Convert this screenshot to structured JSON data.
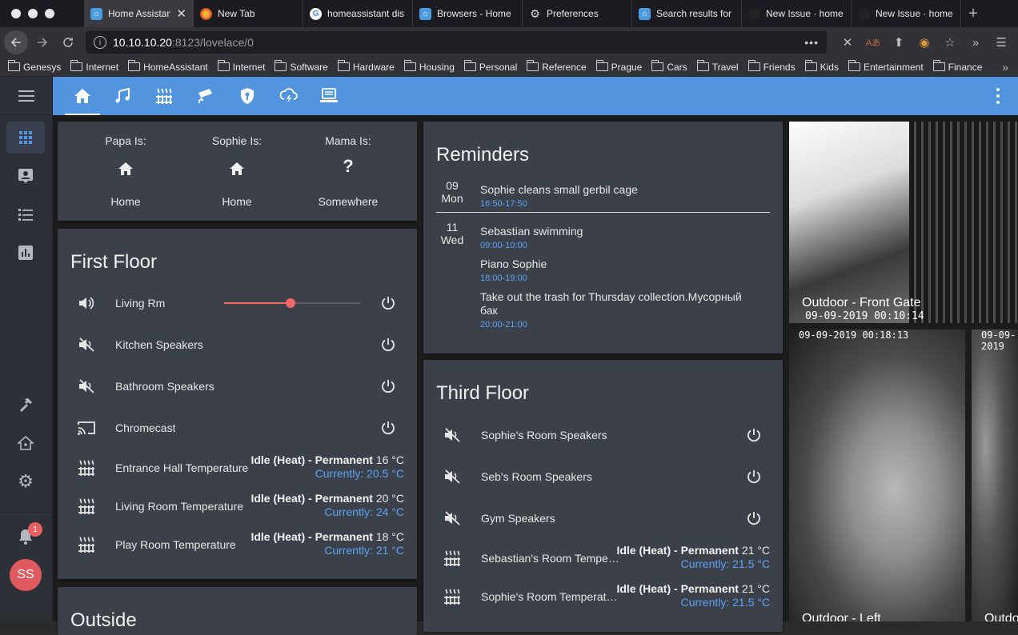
{
  "browser": {
    "tabs": [
      {
        "title": "Home Assistant",
        "favicon": "home-assistant-favicon",
        "active": true
      },
      {
        "title": "New Tab",
        "favicon": "firefox-favicon"
      },
      {
        "title": "homeassistant dis",
        "favicon": "google-favicon"
      },
      {
        "title": "Browsers - Home",
        "favicon": "home-assistant-favicon"
      },
      {
        "title": "Preferences",
        "favicon": "gear-favicon"
      },
      {
        "title": "Search results for",
        "favicon": "home-assistant-favicon"
      },
      {
        "title": "New Issue · home",
        "favicon": "github-favicon"
      },
      {
        "title": "New Issue · home",
        "favicon": "github-favicon"
      }
    ],
    "url_host": "10.10.10.20",
    "url_rest": ":8123/lovelace/0",
    "bookmarks": [
      "Genesys",
      "Internet",
      "HomeAssistant",
      "Internet",
      "Software",
      "Hardware",
      "Housing",
      "Personal",
      "Reference",
      "Prague",
      "Cars",
      "Travel",
      "Friends",
      "Kids",
      "Entertainment",
      "Finance"
    ]
  },
  "ha": {
    "accent": "#5394df",
    "notifications_count": "1",
    "user_initials": "SS",
    "people": [
      {
        "label": "Papa Is:",
        "icon": "home-icon",
        "state": "Home"
      },
      {
        "label": "Sophie Is:",
        "icon": "home-icon",
        "state": "Home"
      },
      {
        "label": "Mama Is:",
        "icon": "question-icon",
        "state": "Somewhere"
      }
    ],
    "first_floor": {
      "title": "First Floor",
      "living_rm": {
        "name": "Living Rm",
        "volume": 0.49
      },
      "media": [
        {
          "name": "Kitchen Speakers",
          "icon": "volume-off-icon"
        },
        {
          "name": "Bathroom Speakers",
          "icon": "volume-off-icon"
        },
        {
          "name": "Chromecast",
          "icon": "cast-icon"
        }
      ],
      "climate": [
        {
          "name": "Entrance Hall Temperature",
          "status": "Idle (Heat) - Permanent",
          "target": "16 °C",
          "current": "Currently: 20.5 °C"
        },
        {
          "name": "Living Room Temperature",
          "status": "Idle (Heat) - Permanent",
          "target": "20 °C",
          "current": "Currently: 24 °C"
        },
        {
          "name": "Play Room Temperature",
          "status": "Idle (Heat) - Permanent",
          "target": "18 °C",
          "current": "Currently: 21 °C"
        }
      ]
    },
    "outside": {
      "title": "Outside"
    },
    "reminders": {
      "title": "Reminders",
      "days": [
        {
          "day": "09",
          "weekday": "Mon",
          "events": [
            {
              "title": "Sophie cleans small gerbil cage",
              "time": "16:50-17:50"
            }
          ]
        },
        {
          "day": "11",
          "weekday": "Wed",
          "events": [
            {
              "title": "Sebastian swimming",
              "time": "09:00-10:00"
            },
            {
              "title": "Piano Sophie",
              "time": "18:00-19:00"
            },
            {
              "title": "Take out the trash for Thursday collection.Мусорный бак",
              "time": "20:00-21:00"
            }
          ]
        }
      ]
    },
    "third_floor": {
      "title": "Third Floor",
      "media": [
        {
          "name": "Sophie's Room Speakers"
        },
        {
          "name": "Seb's Room Speakers"
        },
        {
          "name": "Gym Speakers"
        }
      ],
      "climate": [
        {
          "name": "Sebastian's Room Tempe…",
          "status": "Idle (Heat) - Permanent",
          "target": "21 °C",
          "current": "Currently: 21.5 °C"
        },
        {
          "name": "Sophie's Room Temperat…",
          "status": "Idle (Heat) - Permanent",
          "target": "21 °C",
          "current": "Currently: 21.5 °C"
        }
      ]
    },
    "cameras": [
      {
        "caption": "Outdoor - Front Gate",
        "timestamp": "09-09-2019 00:10:14"
      },
      {
        "caption": "Outdoor - Left",
        "timestamp": "09-09-2019 00:18:13"
      },
      {
        "caption": "Outdoor",
        "timestamp": "09-09-2019"
      }
    ]
  }
}
